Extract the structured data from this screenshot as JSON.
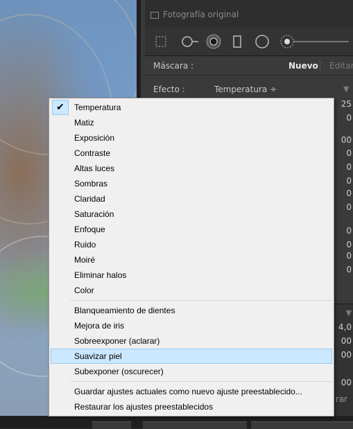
{
  "panel": {
    "photo_original_label": "Fotografía original",
    "mask_label": "Máscara :",
    "mask_new": "Nuevo",
    "mask_edit": "Editar",
    "effect_label": "Efecto :",
    "effect_value": "Temperatura ÷",
    "slider_values": [
      "25",
      "0",
      "00",
      "0",
      "0",
      "0",
      "0",
      "0",
      "0",
      "0",
      "0",
      "0"
    ],
    "lower_values": [
      "4,0",
      "00",
      "00",
      "00"
    ],
    "lower_label_partial": "rar"
  },
  "menu": {
    "group1": [
      {
        "label": "Temperatura",
        "checked": true
      },
      {
        "label": "Matiz"
      },
      {
        "label": "Exposición"
      },
      {
        "label": "Contraste"
      },
      {
        "label": "Altas luces"
      },
      {
        "label": "Sombras"
      },
      {
        "label": "Claridad"
      },
      {
        "label": "Saturación"
      },
      {
        "label": "Enfoque"
      },
      {
        "label": "Ruido"
      },
      {
        "label": "Moiré"
      },
      {
        "label": "Eliminar halos"
      },
      {
        "label": "Color"
      }
    ],
    "group2": [
      {
        "label": "Blanqueamiento de dientes"
      },
      {
        "label": "Mejora de iris"
      },
      {
        "label": "Sobreexponer (aclarar)"
      },
      {
        "label": "Suavizar piel",
        "highlighted": true
      },
      {
        "label": "Subexponer (oscurecer)"
      }
    ],
    "group3": [
      {
        "label": "Guardar ajustes actuales como nuevo ajuste preestablecido..."
      },
      {
        "label": "Restaurar los ajustes preestablecidos"
      }
    ]
  }
}
